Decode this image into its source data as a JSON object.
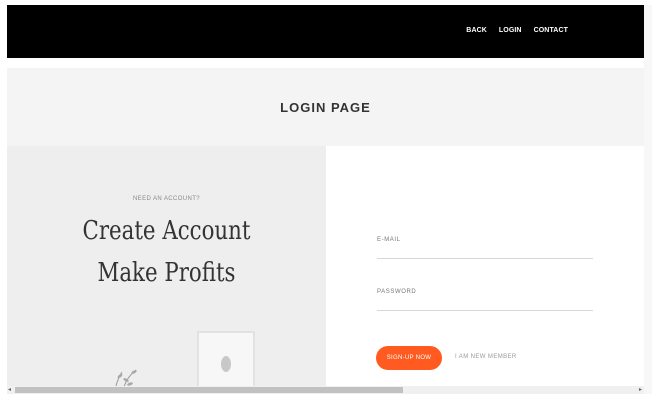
{
  "nav": {
    "items": [
      {
        "label": "BACK"
      },
      {
        "label": "LOGIN"
      },
      {
        "label": "CONTACT"
      }
    ]
  },
  "header": {
    "title": "LOGIN PAGE"
  },
  "promo": {
    "eyebrow": "NEED AN ACCOUNT?",
    "headline_line1": "Create Account",
    "headline_line2": "Make Profits"
  },
  "form": {
    "email_label": "E-MAIL",
    "email_value": "",
    "password_label": "PASSWORD",
    "password_value": "",
    "signup_label": "SIGN-UP NOW",
    "member_link_label": "I AM NEW MEMBER"
  },
  "colors": {
    "accent": "#ff5a1f",
    "topbar": "#000000",
    "header_band": "#f4f4f4",
    "left_panel": "#eeeeee"
  },
  "icons": {
    "scroll_left": "triangle-left-icon",
    "scroll_right": "triangle-right-icon"
  }
}
